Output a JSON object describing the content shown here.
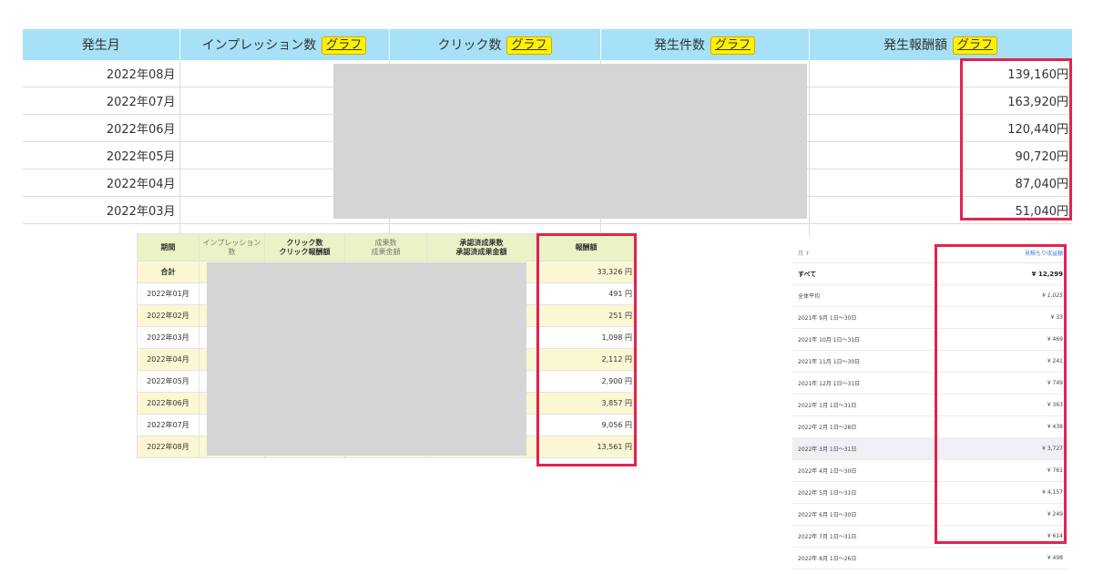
{
  "top_table": {
    "headers": {
      "month": "発生月",
      "impressions": "インプレッション数",
      "clicks": "クリック数",
      "occurrences": "発生件数",
      "reward": "発生報酬額"
    },
    "graph_label": "グラフ",
    "rows": [
      {
        "month": "2022年08月",
        "reward": "139,160円"
      },
      {
        "month": "2022年07月",
        "reward": "163,920円"
      },
      {
        "month": "2022年06月",
        "reward": "120,440円"
      },
      {
        "month": "2022年05月",
        "reward": "90,720円"
      },
      {
        "month": "2022年04月",
        "reward": "87,040円"
      },
      {
        "month": "2022年03月",
        "reward": "51,040円"
      }
    ]
  },
  "mid_table": {
    "headers": {
      "period": "期間",
      "impressions": "インプレッション数",
      "clicks_line1": "クリック数",
      "clicks_line2": "クリック報酬額",
      "results_line1": "成果数",
      "results_line2": "成果金額",
      "approved_line1": "承認済成果数",
      "approved_line2": "承認済成果金額",
      "reward": "報酬額"
    },
    "total_label": "合計",
    "total_reward": "33,326 円",
    "rows": [
      {
        "period": "2022年01月",
        "reward": "491 円"
      },
      {
        "period": "2022年02月",
        "reward": "251 円"
      },
      {
        "period": "2022年03月",
        "reward": "1,098 円"
      },
      {
        "period": "2022年04月",
        "reward": "2,112 円"
      },
      {
        "period": "2022年05月",
        "reward": "2,900 円"
      },
      {
        "period": "2022年06月",
        "reward": "3,857 円"
      },
      {
        "period": "2022年07月",
        "reward": "9,056 円"
      },
      {
        "period": "2022年08月",
        "reward": "13,561 円"
      }
    ]
  },
  "right_table": {
    "header_left": "月",
    "header_right": "見積もり収益額",
    "rows": [
      {
        "label": "すべて",
        "value": "¥ 12,299"
      },
      {
        "label": "全体平均",
        "value": "¥ 1,025"
      },
      {
        "label": "2021年 9月 1日～30日",
        "value": "¥ 33"
      },
      {
        "label": "2021年 10月 1日～31日",
        "value": "¥ 469"
      },
      {
        "label": "2021年 11月 1日～30日",
        "value": "¥ 241"
      },
      {
        "label": "2021年 12月 1日～31日",
        "value": "¥ 749"
      },
      {
        "label": "2022年 1月 1日～31日",
        "value": "¥ 363"
      },
      {
        "label": "2022年 2月 1日～28日",
        "value": "¥ 438"
      },
      {
        "label": "2022年 3月 1日～31日",
        "value": "¥ 3,727"
      },
      {
        "label": "2022年 4月 1日～30日",
        "value": "¥ 761"
      },
      {
        "label": "2022年 5月 1日～31日",
        "value": "¥ 4,157"
      },
      {
        "label": "2022年 6月 1日～30日",
        "value": "¥ 249"
      },
      {
        "label": "2022年 7月 1日～31日",
        "value": "¥ 614"
      },
      {
        "label": "2022年 8月 1日～26日",
        "value": "¥ 498"
      }
    ]
  },
  "colors": {
    "top_header_bg": "#a6e1f7",
    "graph_button_bg": "#fff200",
    "mid_header_bg": "#e9f3c6",
    "mid_row_alt_bg": "#fbf7d3",
    "highlight_border": "#e0244e",
    "redaction_gray": "#d5d5d5"
  }
}
